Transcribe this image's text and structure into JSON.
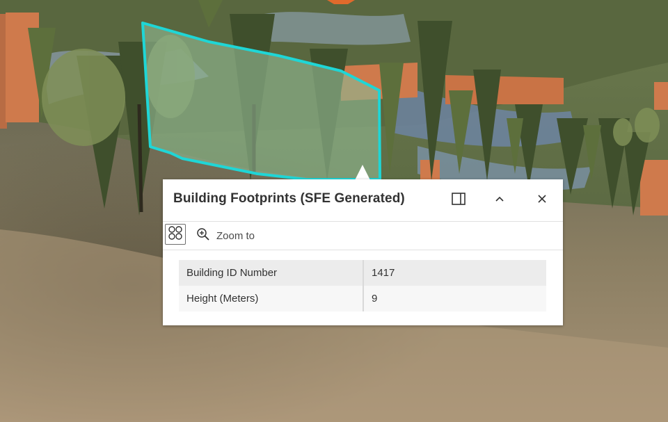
{
  "colors": {
    "selection_outline": "#1fd6d6",
    "selection_fill": "#8fb68f",
    "building": "#cf7a4c",
    "popup_background": "#ffffff",
    "text": "#323232"
  },
  "map": {
    "view": "3D scene",
    "selected_feature": "building footprint (highlighted)"
  },
  "popup": {
    "title": "Building Footprints (SFE Generated)",
    "header_icons": {
      "dock": "dock-icon",
      "collapse": "chevron-up-icon",
      "close": "close-icon"
    },
    "actions": {
      "menu_icon": "action-menu-icon",
      "zoom_icon": "zoom-in-icon",
      "zoom_label": "Zoom to"
    },
    "attributes": [
      {
        "field": "Building ID Number",
        "value": "1417"
      },
      {
        "field": "Height (Meters)",
        "value": "9"
      }
    ]
  }
}
